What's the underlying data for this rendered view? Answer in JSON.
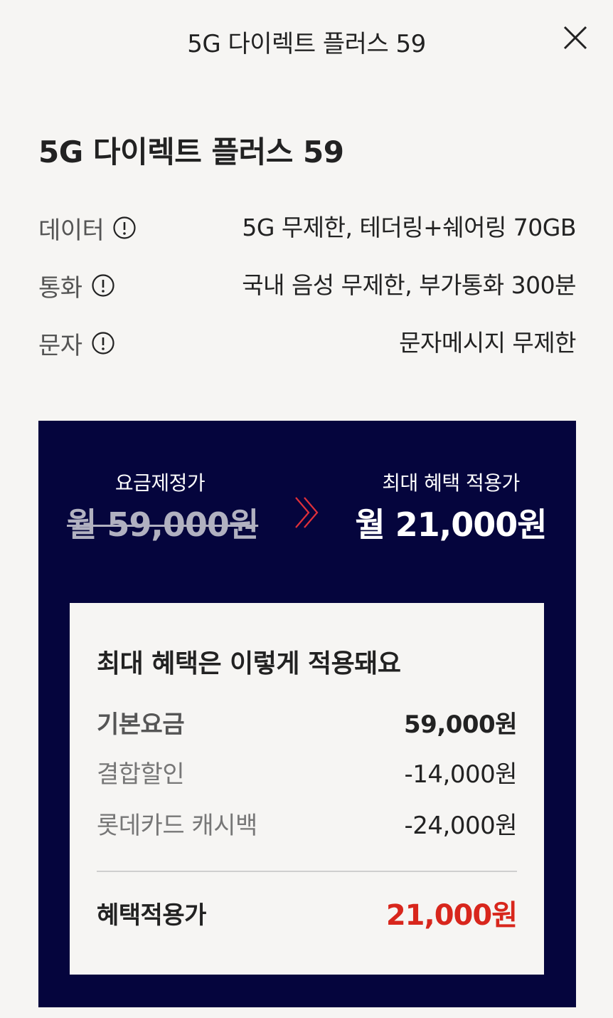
{
  "header": {
    "title": "5G 다이렉트 플러스 59",
    "close_icon": "close-icon"
  },
  "plan": {
    "name": "5G 다이렉트 플러스 59"
  },
  "specs": [
    {
      "label": "데이터",
      "value": "5G 무제한, 테더링+쉐어링 70GB",
      "icon": "info-icon"
    },
    {
      "label": "통화",
      "value": "국내 음성 무제한, 부가통화 300분",
      "icon": "info-icon"
    },
    {
      "label": "문자",
      "value": "문자메시지 무제한",
      "icon": "info-icon"
    }
  ],
  "price": {
    "original_caption": "요금제정가",
    "original_amount": "월 59,000원",
    "benefit_caption": "최대 혜택 적용가",
    "benefit_amount": "월 21,000원",
    "arrow_icon": "double-chevron-right-icon"
  },
  "benefit_breakdown": {
    "title": "최대 혜택은 이렇게 적용돼요",
    "lines": [
      {
        "label": "기본요금",
        "value": "59,000원"
      },
      {
        "label": "결합할인",
        "value": "-14,000원"
      },
      {
        "label": "롯데카드 캐시백",
        "value": "-24,000원"
      }
    ],
    "total_label": "혜택적용가",
    "total_value": "21,000원"
  },
  "colors": {
    "background": "#f6f5f3",
    "panel_navy": "#05053d",
    "accent_red": "#d8261c",
    "chevron_red": "#e0303a"
  }
}
